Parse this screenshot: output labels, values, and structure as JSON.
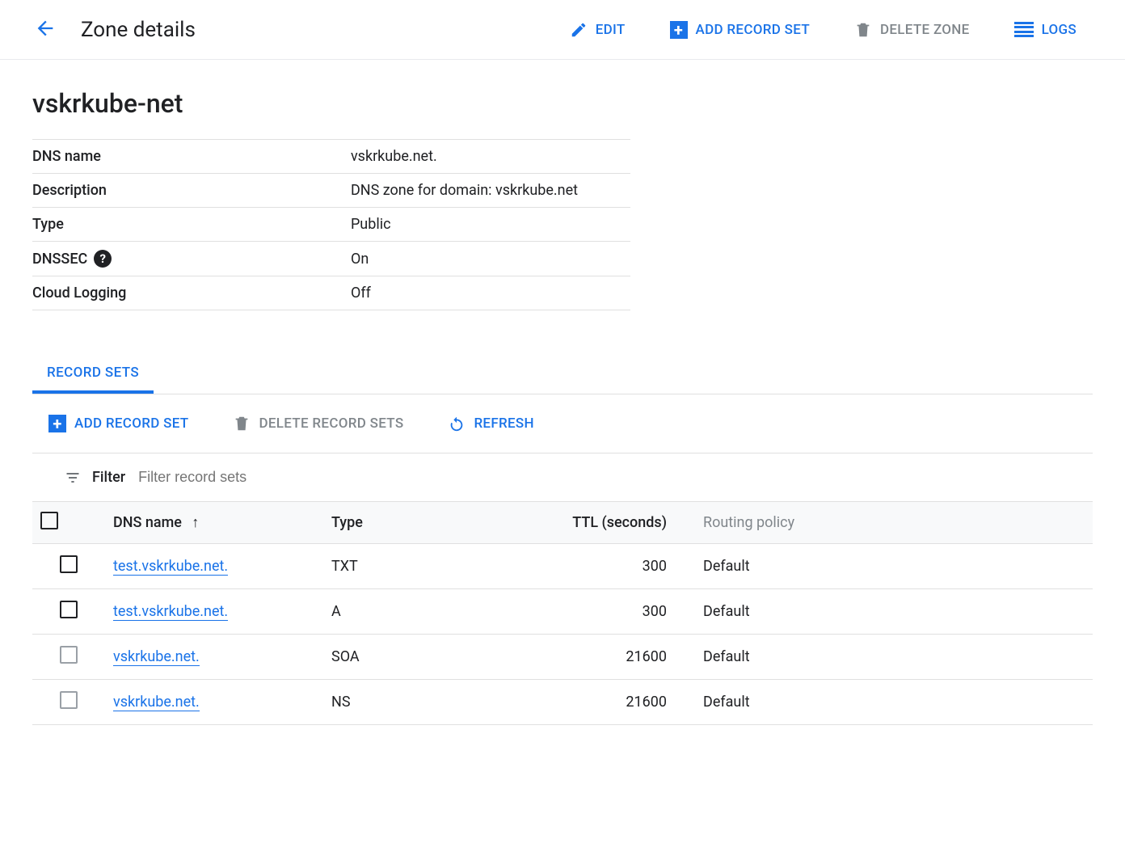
{
  "header": {
    "page_title": "Zone details",
    "actions": {
      "edit": "EDIT",
      "add_record_set": "ADD RECORD SET",
      "delete_zone": "DELETE ZONE",
      "logs": "LOGS"
    }
  },
  "zone": {
    "name": "vskrkube-net",
    "meta": {
      "labels": {
        "dns_name": "DNS name",
        "description": "Description",
        "type": "Type",
        "dnssec": "DNSSEC",
        "cloud_logging": "Cloud Logging"
      },
      "values": {
        "dns_name": "vskrkube.net.",
        "description": "DNS zone for domain: vskrkube.net",
        "type": "Public",
        "dnssec": "On",
        "cloud_logging": "Off"
      }
    }
  },
  "tabs": {
    "record_sets": "RECORD SETS"
  },
  "toolbar": {
    "add_record_set": "ADD RECORD SET",
    "delete_record_sets": "DELETE RECORD SETS",
    "refresh": "REFRESH"
  },
  "filter": {
    "label": "Filter",
    "placeholder": "Filter record sets"
  },
  "table": {
    "columns": {
      "dns_name": "DNS name",
      "type": "Type",
      "ttl": "TTL (seconds)",
      "routing_policy": "Routing policy"
    },
    "rows": [
      {
        "dns_name": "test.vskrkube.net.",
        "type": "TXT",
        "ttl": "300",
        "routing_policy": "Default",
        "muted": false
      },
      {
        "dns_name": "test.vskrkube.net.",
        "type": "A",
        "ttl": "300",
        "routing_policy": "Default",
        "muted": false
      },
      {
        "dns_name": "vskrkube.net.",
        "type": "SOA",
        "ttl": "21600",
        "routing_policy": "Default",
        "muted": true
      },
      {
        "dns_name": "vskrkube.net.",
        "type": "NS",
        "ttl": "21600",
        "routing_policy": "Default",
        "muted": true
      }
    ]
  }
}
